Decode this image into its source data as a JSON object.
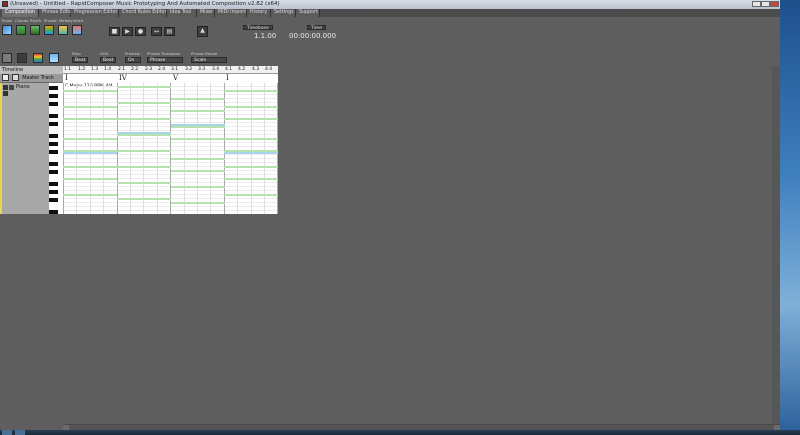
{
  "window": {
    "title": "(Unsaved) - Untitled - RapidComposer Music Prototyping And Automated Composition v2.82 (x64)"
  },
  "tabs": [
    "Composition",
    "Phrase Editor",
    "Progression Editor",
    "Chord Rules Editor",
    "Idea Tool",
    "Mixer",
    "MIDI Import",
    "History",
    "Settings",
    "Support"
  ],
  "toolbar": {
    "group_labels": [
      "Rules",
      "Chords",
      "Rhyth",
      "Phrase",
      "Melody",
      "Voice"
    ],
    "step_label": "Step",
    "step_value": "Beat",
    "grid_label": "Grid",
    "grid_value": "Beat",
    "preview_label": "Preview",
    "preview_value": "On",
    "phrase_transpose_label": "Phrase Transpose",
    "phrase_transpose_value": "Phrase",
    "phrase_resize_label": "Phrase Resize",
    "phrase_resize_value": "Scale"
  },
  "transport": {
    "timebase_label": "Timebase",
    "timebase_value": "1.1.00",
    "time_label": "Time",
    "time_value": "00:00:00.000"
  },
  "timeline": {
    "label": "Timeline",
    "ticks": [
      "1.1",
      "1.2",
      "1.3",
      "1.4",
      "2.1",
      "2.2",
      "2.3",
      "2.4",
      "3.1",
      "3.2",
      "3.3",
      "3.4",
      "4.1",
      "4.2",
      "4.3",
      "4.4"
    ]
  },
  "tracks": {
    "master_label": "Master Track",
    "piano_label": "Piano"
  },
  "chords": [
    "I",
    "IV",
    "V",
    "I"
  ],
  "key_info": "C Major  120 BPM  4/4",
  "colors": {
    "chord_tone": "#b6e3ad",
    "root_tone": "#a9d4ee",
    "track_accent": "#e6d84a"
  }
}
